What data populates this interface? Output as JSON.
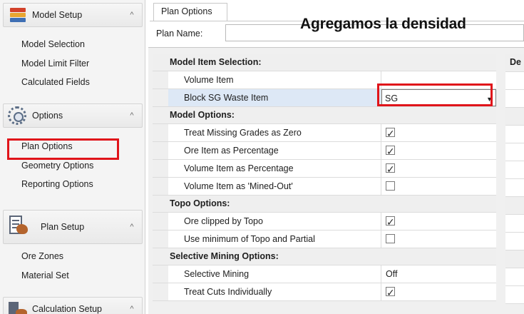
{
  "overlay_title": "Agregamos la densidad",
  "sidebar": {
    "sections": [
      {
        "title": "Model Setup",
        "icon": "layers-icon",
        "items": [
          "Model Selection",
          "Model Limit Filter",
          "Calculated Fields"
        ]
      },
      {
        "title": "Options",
        "icon": "gears-icon",
        "items": [
          "Plan Options",
          "Geometry Options",
          "Reporting Options"
        ]
      },
      {
        "title": "Plan Setup",
        "icon": "plan-sheet-icon",
        "items": [
          "Ore Zones",
          "Material Set"
        ]
      },
      {
        "title": "Calculation Setup",
        "icon": "calculator-icon",
        "items": []
      }
    ],
    "chevron": "^",
    "selected_item": "Plan Options"
  },
  "tabs": [
    {
      "label": "Plan Options",
      "active": true
    }
  ],
  "plan_name": {
    "label": "Plan Name:",
    "value": ""
  },
  "grid": {
    "categories": [
      {
        "label": "Model Item Selection:",
        "rows": [
          {
            "name": "Volume Item",
            "type": "text",
            "value": ""
          },
          {
            "name": "Block SG Waste Item",
            "type": "dropdown",
            "value": "SG",
            "selected": true
          }
        ]
      },
      {
        "label": "Model Options:",
        "rows": [
          {
            "name": "Treat Missing Grades as Zero",
            "type": "checkbox",
            "checked": true
          },
          {
            "name": "Ore Item as Percentage",
            "type": "checkbox",
            "checked": true
          },
          {
            "name": "Volume Item as Percentage",
            "type": "checkbox",
            "checked": true
          },
          {
            "name": "Volume Item as 'Mined-Out'",
            "type": "checkbox",
            "checked": false
          }
        ]
      },
      {
        "label": "Topo Options:",
        "rows": [
          {
            "name": "Ore clipped by Topo",
            "type": "checkbox",
            "checked": true
          },
          {
            "name": "Use minimum of Topo and Partial",
            "type": "checkbox",
            "checked": false
          }
        ]
      },
      {
        "label": "Selective Mining Options:",
        "rows": [
          {
            "name": "Selective Mining",
            "type": "text",
            "value": "Off"
          },
          {
            "name": "Treat Cuts Individually",
            "type": "checkbox",
            "checked": true
          }
        ]
      }
    ],
    "right_grid_header": "De"
  },
  "colors": {
    "highlight_red": "#e0141a",
    "selection_blue": "#dde8f6"
  }
}
